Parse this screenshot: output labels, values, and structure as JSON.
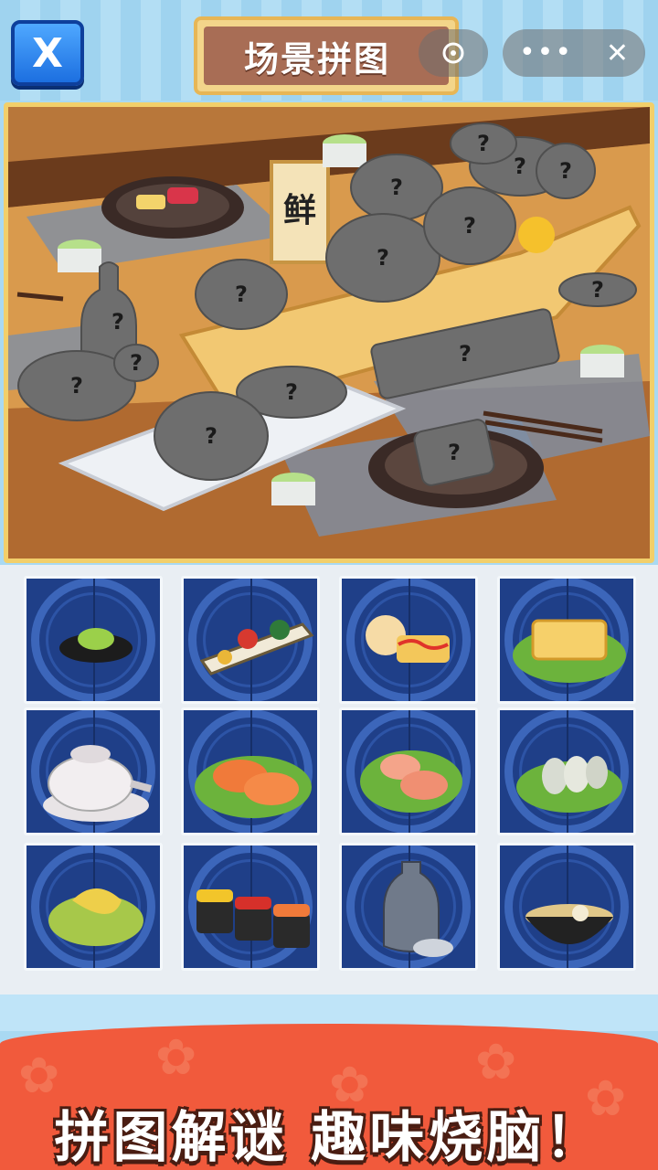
{
  "header": {
    "close_glyph": "X",
    "title": "场景拼图",
    "more_glyph": "•••",
    "capsule_close_glyph": "✕"
  },
  "scene": {
    "sign_char": "鲜",
    "slot_marker": "?",
    "slots": [
      {
        "name": "slot-sake-bottle"
      },
      {
        "name": "slot-teapot"
      },
      {
        "name": "slot-dumpling-plate"
      },
      {
        "name": "slot-tamago"
      },
      {
        "name": "slot-seaweed-salad"
      },
      {
        "name": "slot-salmon-sashimi"
      },
      {
        "name": "slot-tuna-sashimi"
      },
      {
        "name": "slot-mackerel"
      },
      {
        "name": "slot-sake-cup"
      },
      {
        "name": "slot-wasabi-dish"
      },
      {
        "name": "slot-pickled-ginger"
      },
      {
        "name": "slot-sushi-tray"
      },
      {
        "name": "slot-nigiri-set"
      },
      {
        "name": "slot-soup-bowl"
      },
      {
        "name": "slot-condiment-tray"
      }
    ]
  },
  "pieces": [
    {
      "id": "wasabi-dish"
    },
    {
      "id": "condiment-tray"
    },
    {
      "id": "tamago-with-bun"
    },
    {
      "id": "tamago-on-leaf"
    },
    {
      "id": "teapot"
    },
    {
      "id": "salmon-sashimi"
    },
    {
      "id": "tuna-sashimi"
    },
    {
      "id": "mackerel-slices"
    },
    {
      "id": "pickled-ginger"
    },
    {
      "id": "nigiri-set"
    },
    {
      "id": "sake-set"
    },
    {
      "id": "soup-bowl"
    }
  ],
  "footer": {
    "slogan": "拼图解谜  趣味烧脑！"
  },
  "colors": {
    "accent_blue": "#1c6fe0",
    "tile_navy": "#1f3f88",
    "banner_red": "#f15a3c",
    "frame_gold": "#f2cf6a",
    "silhouette_gray": "#6e6e6e"
  }
}
